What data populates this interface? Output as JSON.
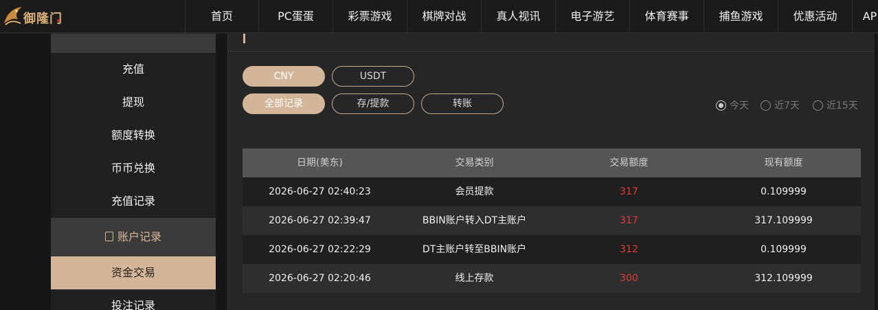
{
  "brand": {
    "name": "御隆门"
  },
  "nav": {
    "items": [
      "首页",
      "PC蛋蛋",
      "彩票游戏",
      "棋牌对战",
      "真人视讯",
      "电子游艺",
      "体育赛事",
      "捕鱼游戏",
      "优惠活动",
      "AP"
    ]
  },
  "sidebar": {
    "items": [
      "充值",
      "提现",
      "额度转换",
      "币币兑换",
      "充值记录"
    ],
    "group_label": "账户记录",
    "active_label": "资金交易",
    "next_label": "投注记录"
  },
  "currency_tabs": [
    "CNY",
    "USDT"
  ],
  "filter_tabs": [
    "全部记录",
    "存/提款",
    "转账"
  ],
  "date_range": [
    "今天",
    "近7天",
    "近15天"
  ],
  "table": {
    "headers": [
      "日期(美东)",
      "交易类别",
      "交易额度",
      "现有额度"
    ],
    "rows": [
      [
        "2026-06-27 02:40:23",
        "会员提款",
        "317",
        "0.109999"
      ],
      [
        "2026-06-27 02:39:47",
        "BBIN账户转入DT主账户",
        "317",
        "317.109999"
      ],
      [
        "2026-06-27 02:22:29",
        "DT主账户转至BBIN账户",
        "312",
        "0.109999"
      ],
      [
        "2026-06-27 02:20:46",
        "线上存款",
        "300",
        "312.109999"
      ]
    ]
  },
  "colors": {
    "accent": "#d3b699",
    "amount": "#e23a3a",
    "brand": "#d9b07a"
  }
}
